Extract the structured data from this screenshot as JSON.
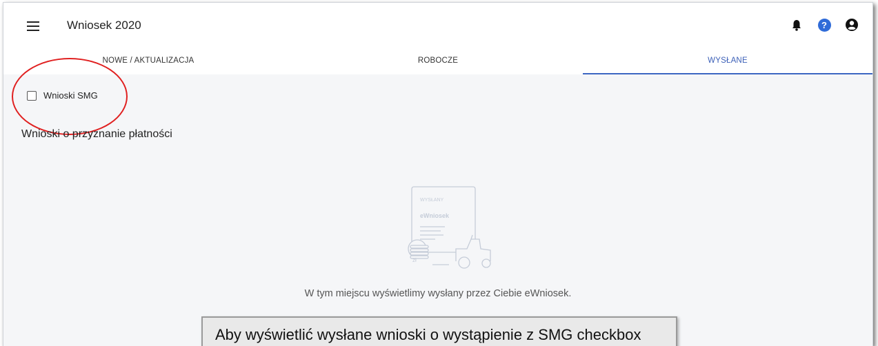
{
  "appbar": {
    "title": "Wniosek 2020",
    "icons": [
      "menu-icon",
      "bell-icon",
      "help-icon",
      "account-icon"
    ],
    "help_glyph": "?"
  },
  "tabs": [
    {
      "label": "NOWE / AKTUALIZACJA",
      "active": false
    },
    {
      "label": "ROBOCZE",
      "active": false
    },
    {
      "label": "WYSŁANE",
      "active": true
    }
  ],
  "filter": {
    "checkbox_label": "Wnioski SMG",
    "checked": false
  },
  "section": {
    "title": "Wnioski o przyznanie płatności"
  },
  "empty_state": {
    "illustration_badge": "WYSŁANY",
    "illustration_title": "eWniosek",
    "illustration_coin": "zł",
    "message": "W tym miejscu wyświetlimy wysłany przez Ciebie eWniosek."
  },
  "annotation": {
    "callout_text": "Aby wyświetlić wysłane wnioski o wystąpienie z SMG checkbox",
    "highlight_color": "#e02020"
  },
  "colors": {
    "accent": "#3b66c2",
    "help_icon": "#2f6bd8"
  }
}
